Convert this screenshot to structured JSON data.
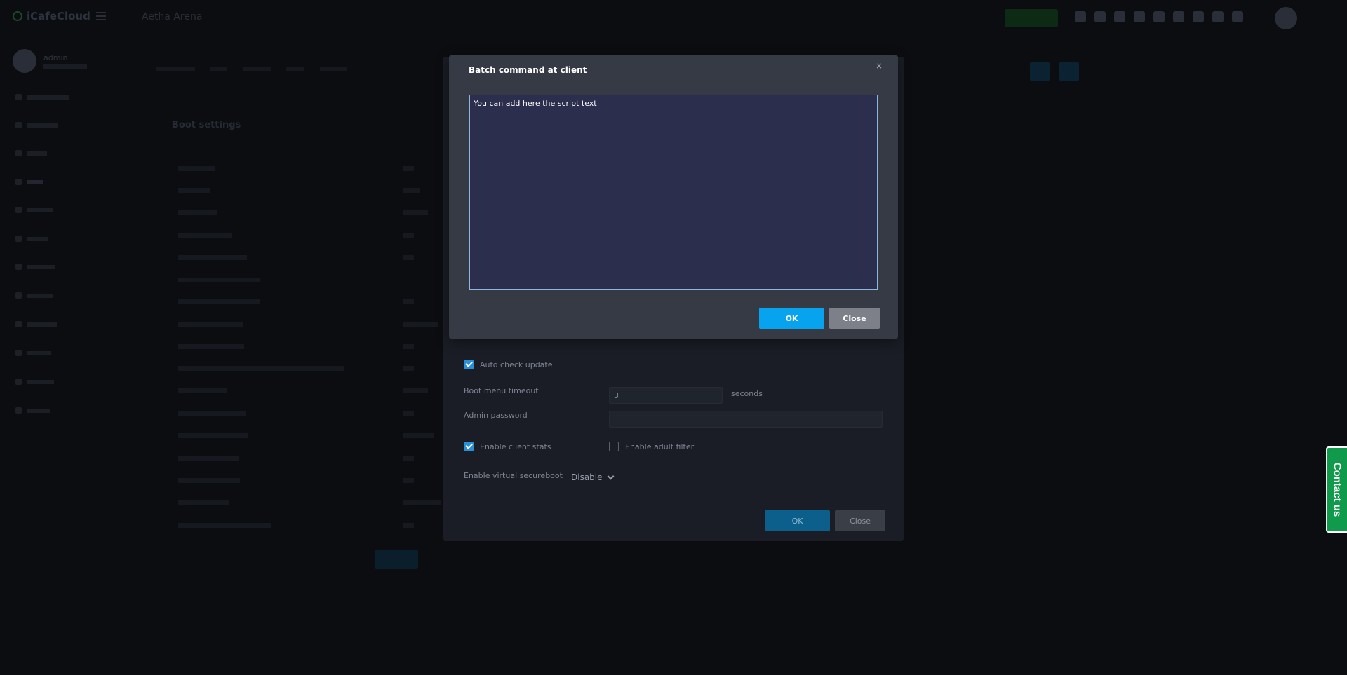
{
  "background": {
    "brand": "iCafeCloud",
    "cafe_name": "Aetha Arena",
    "user": "admin",
    "page_title": "Boot settings"
  },
  "outer_modal": {
    "auto_check_update": {
      "label": "Auto check update",
      "checked": true
    },
    "boot_menu_timeout": {
      "label": "Boot menu timeout",
      "value": "3",
      "unit": "seconds"
    },
    "admin_password": {
      "label": "Admin password",
      "value": ""
    },
    "enable_client_stats": {
      "label": "Enable client stats",
      "checked": true
    },
    "enable_adult_filter": {
      "label": "Enable adult filter",
      "checked": false
    },
    "virtual_secureboot": {
      "label": "Enable virtual secureboot",
      "selected": "Disable"
    },
    "ok_label": "OK",
    "close_label": "Close"
  },
  "dialog": {
    "title": "Batch command at client",
    "close_glyph": "×",
    "script_text": "You can add here the script text",
    "ok_label": "OK",
    "close_label": "Close"
  },
  "contact": {
    "label": "Contact us"
  },
  "colors": {
    "dialog_bg": "#363a45",
    "textarea_bg": "#2b2e4d",
    "ok_button": "#07a3ee",
    "close_button": "#7d8089",
    "contact_tab": "#0f9a4c",
    "checkbox_checked": "#2a8fd6"
  }
}
